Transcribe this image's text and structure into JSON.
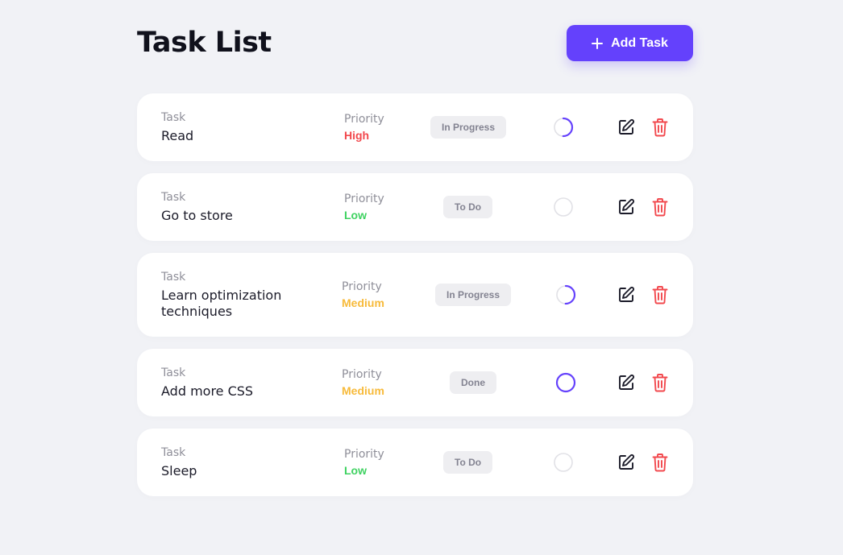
{
  "header": {
    "title": "Task List",
    "add_button_label": "Add Task"
  },
  "labels": {
    "task": "Task",
    "priority": "Priority"
  },
  "colors": {
    "accent": "#6441fc",
    "priority_high": "#f2484d",
    "priority_medium": "#f7ba3a",
    "priority_low": "#3fd261",
    "delete": "#f2484d",
    "progress_track": "#e1e1e6"
  },
  "tasks": [
    {
      "name": "Read",
      "priority": "High",
      "priority_level": "high",
      "status": "In Progress",
      "progress": 0.5
    },
    {
      "name": "Go to store",
      "priority": "Low",
      "priority_level": "low",
      "status": "To Do",
      "progress": 0
    },
    {
      "name": "Learn optimization techniques",
      "priority": "Medium",
      "priority_level": "medium",
      "status": "In Progress",
      "progress": 0.5
    },
    {
      "name": "Add more CSS",
      "priority": "Medium",
      "priority_level": "medium",
      "status": "Done",
      "progress": 1
    },
    {
      "name": "Sleep",
      "priority": "Low",
      "priority_level": "low",
      "status": "To Do",
      "progress": 0
    }
  ],
  "icons": {
    "add": "plus-icon",
    "edit": "edit-icon",
    "delete": "trash-icon"
  }
}
